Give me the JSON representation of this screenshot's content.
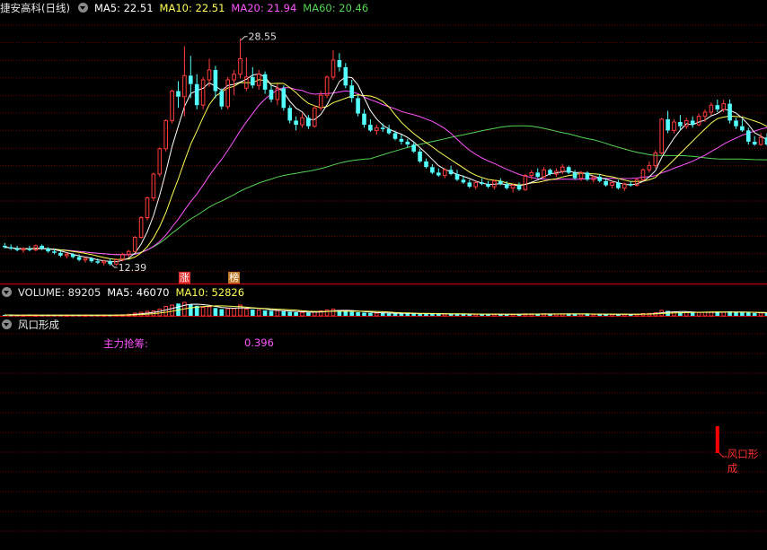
{
  "price_header": {
    "stock_name": "捷安高科",
    "period": "(日线)",
    "ma5": "MA5: 22.51",
    "ma10": "MA10: 22.51",
    "ma20": "MA20: 21.94",
    "ma60": "MA60: 20.46"
  },
  "volume_header": {
    "volume": "VOLUME: 89205",
    "ma5": "MA5: 46070",
    "ma10": "MA10: 52826"
  },
  "indicator_header": {
    "title": "风口形成"
  },
  "indicator": {
    "label": "主力抢筹:",
    "value": "0.396",
    "signal_label": "风口形成",
    "signal_candle_index": 115
  },
  "badges": [
    {
      "text": "涨",
      "candle_index": 29,
      "color": "#e03030"
    },
    {
      "text": "榜",
      "candle_index": 37,
      "color": "#c07a2a"
    }
  ],
  "colors": {
    "up": "#ff3c3c",
    "down": "#54ffff",
    "ma5": "#ffffff",
    "ma10": "#ffff54",
    "ma20": "#ff54ff",
    "ma60": "#54d454",
    "grid": "#7a0000",
    "divider": "#c00000",
    "indicator_text": "#ff54ff",
    "signal": "#ff0000"
  },
  "chart_data": {
    "type": "candlestick",
    "ylim": [
      11.5,
      30.0
    ],
    "annotations": [
      {
        "text": "28.55",
        "candle_index": 38,
        "price": 28.55,
        "kind": "high"
      },
      {
        "text": "12.39",
        "candle_index": 17,
        "price": 12.39,
        "kind": "low"
      }
    ],
    "ohlc": [
      [
        13.8,
        14.0,
        13.6,
        13.7
      ],
      [
        13.7,
        13.9,
        13.5,
        13.6
      ],
      [
        13.6,
        13.8,
        13.4,
        13.5
      ],
      [
        13.5,
        13.7,
        13.3,
        13.6
      ],
      [
        13.6,
        13.8,
        13.4,
        13.5
      ],
      [
        13.5,
        13.9,
        13.4,
        13.8
      ],
      [
        13.8,
        13.9,
        13.5,
        13.6
      ],
      [
        13.6,
        13.7,
        13.3,
        13.4
      ],
      [
        13.4,
        13.6,
        13.2,
        13.3
      ],
      [
        13.3,
        13.5,
        13.0,
        13.1
      ],
      [
        13.1,
        13.3,
        12.9,
        13.2
      ],
      [
        13.2,
        13.3,
        12.9,
        13.0
      ],
      [
        13.0,
        13.2,
        12.7,
        12.8
      ],
      [
        12.8,
        13.0,
        12.6,
        12.9
      ],
      [
        12.9,
        13.0,
        12.6,
        12.7
      ],
      [
        12.7,
        12.9,
        12.5,
        12.6
      ],
      [
        12.6,
        12.8,
        12.4,
        12.7
      ],
      [
        12.7,
        12.9,
        12.39,
        12.5
      ],
      [
        12.5,
        12.9,
        12.4,
        12.8
      ],
      [
        12.8,
        13.3,
        12.7,
        13.2
      ],
      [
        13.2,
        13.5,
        13.0,
        13.4
      ],
      [
        13.4,
        14.5,
        13.3,
        14.4
      ],
      [
        14.4,
        15.9,
        14.3,
        15.8
      ],
      [
        15.8,
        17.3,
        15.6,
        17.2
      ],
      [
        17.2,
        19.0,
        17.0,
        18.9
      ],
      [
        18.9,
        20.8,
        18.7,
        20.7
      ],
      [
        20.7,
        22.8,
        20.5,
        22.7
      ],
      [
        22.7,
        24.9,
        22.5,
        24.8
      ],
      [
        24.8,
        25.5,
        23.6,
        24.4
      ],
      [
        24.4,
        28.0,
        23.0,
        25.9
      ],
      [
        25.9,
        27.3,
        24.3,
        25.3
      ],
      [
        25.3,
        26.0,
        23.5,
        23.8
      ],
      [
        23.8,
        25.8,
        23.5,
        25.6
      ],
      [
        25.6,
        27.1,
        25.1,
        26.3
      ],
      [
        26.3,
        26.6,
        24.3,
        24.8
      ],
      [
        24.8,
        25.0,
        23.5,
        23.7
      ],
      [
        23.7,
        25.8,
        23.5,
        25.6
      ],
      [
        25.6,
        26.3,
        24.5,
        26.0
      ],
      [
        26.0,
        28.55,
        25.7,
        27.1
      ],
      [
        25.0,
        27.2,
        24.8,
        25.8
      ],
      [
        25.8,
        26.5,
        25.0,
        25.2
      ],
      [
        25.2,
        26.3,
        24.9,
        26.0
      ],
      [
        26.0,
        26.2,
        24.6,
        24.9
      ],
      [
        24.9,
        25.2,
        24.0,
        24.2
      ],
      [
        24.2,
        25.3,
        23.8,
        25.0
      ],
      [
        25.0,
        25.2,
        23.4,
        23.6
      ],
      [
        23.6,
        23.8,
        22.5,
        22.7
      ],
      [
        22.7,
        23.0,
        22.0,
        22.4
      ],
      [
        22.4,
        23.2,
        22.2,
        22.9
      ],
      [
        22.9,
        23.1,
        22.1,
        22.3
      ],
      [
        22.3,
        23.8,
        22.2,
        23.6
      ],
      [
        23.6,
        24.8,
        23.4,
        24.5
      ],
      [
        24.5,
        25.9,
        24.3,
        25.8
      ],
      [
        25.8,
        27.7,
        25.6,
        27.0
      ],
      [
        27.0,
        27.5,
        26.2,
        26.5
      ],
      [
        26.5,
        26.8,
        25.0,
        25.2
      ],
      [
        25.2,
        25.6,
        24.0,
        24.3
      ],
      [
        24.3,
        24.5,
        23.0,
        23.2
      ],
      [
        23.2,
        23.5,
        22.2,
        22.4
      ],
      [
        22.4,
        22.8,
        21.9,
        22.0
      ],
      [
        22.0,
        22.4,
        21.7,
        22.2
      ],
      [
        22.2,
        22.5,
        21.9,
        22.1
      ],
      [
        22.1,
        22.4,
        21.7,
        21.8
      ],
      [
        21.8,
        22.0,
        21.3,
        21.4
      ],
      [
        21.4,
        21.7,
        21.0,
        21.2
      ],
      [
        21.2,
        21.4,
        20.8,
        21.0
      ],
      [
        21.0,
        21.2,
        20.4,
        20.5
      ],
      [
        20.5,
        20.7,
        19.7,
        19.8
      ],
      [
        19.8,
        20.0,
        19.3,
        19.4
      ],
      [
        19.4,
        19.6,
        18.9,
        19.0
      ],
      [
        19.0,
        19.3,
        18.7,
        18.8
      ],
      [
        18.8,
        19.3,
        18.6,
        19.2
      ],
      [
        19.2,
        19.5,
        18.8,
        18.9
      ],
      [
        18.9,
        19.2,
        18.4,
        18.5
      ],
      [
        18.5,
        18.8,
        18.2,
        18.3
      ],
      [
        18.3,
        18.5,
        17.9,
        18.0
      ],
      [
        18.0,
        18.4,
        17.8,
        18.3
      ],
      [
        18.3,
        18.6,
        18.1,
        18.2
      ],
      [
        18.2,
        18.4,
        17.9,
        18.0
      ],
      [
        18.0,
        18.5,
        17.8,
        18.4
      ],
      [
        18.4,
        18.6,
        18.1,
        18.2
      ],
      [
        18.2,
        18.4,
        17.8,
        17.9
      ],
      [
        17.9,
        18.2,
        17.6,
        18.1
      ],
      [
        18.1,
        18.3,
        17.7,
        17.8
      ],
      [
        17.8,
        18.9,
        17.7,
        18.8
      ],
      [
        18.8,
        19.2,
        18.5,
        19.0
      ],
      [
        19.0,
        19.3,
        18.6,
        18.7
      ],
      [
        18.7,
        19.4,
        18.6,
        19.2
      ],
      [
        19.2,
        19.3,
        18.8,
        18.9
      ],
      [
        18.9,
        19.3,
        18.7,
        19.1
      ],
      [
        19.1,
        19.6,
        18.9,
        19.4
      ],
      [
        19.4,
        19.5,
        18.9,
        19.0
      ],
      [
        19.0,
        19.2,
        18.5,
        18.6
      ],
      [
        18.6,
        19.1,
        18.4,
        19.0
      ],
      [
        19.0,
        19.1,
        18.4,
        18.5
      ],
      [
        18.5,
        18.8,
        18.3,
        18.7
      ],
      [
        18.7,
        18.9,
        18.3,
        18.4
      ],
      [
        18.4,
        18.6,
        18.0,
        18.1
      ],
      [
        18.1,
        18.4,
        17.9,
        18.3
      ],
      [
        18.3,
        18.5,
        17.8,
        17.9
      ],
      [
        17.9,
        18.3,
        17.7,
        18.2
      ],
      [
        18.2,
        18.4,
        18.0,
        18.1
      ],
      [
        18.1,
        18.6,
        18.0,
        18.5
      ],
      [
        18.5,
        19.3,
        18.4,
        19.2
      ],
      [
        19.2,
        19.8,
        19.0,
        19.5
      ],
      [
        19.5,
        20.6,
        19.3,
        20.4
      ],
      [
        20.4,
        22.9,
        20.3,
        22.8
      ],
      [
        22.8,
        23.4,
        21.8,
        22.0
      ],
      [
        22.0,
        22.8,
        21.8,
        22.6
      ],
      [
        22.6,
        23.1,
        22.0,
        22.3
      ],
      [
        22.3,
        22.9,
        22.1,
        22.7
      ],
      [
        22.7,
        23.0,
        22.2,
        22.4
      ],
      [
        22.4,
        23.2,
        22.3,
        23.0
      ],
      [
        23.0,
        23.5,
        22.6,
        23.3
      ],
      [
        23.3,
        24.0,
        23.1,
        23.8
      ],
      [
        23.8,
        24.2,
        23.3,
        23.5
      ],
      [
        23.5,
        24.2,
        23.3,
        23.9
      ],
      [
        23.9,
        24.2,
        22.5,
        22.7
      ],
      [
        22.7,
        22.9,
        22.1,
        22.3
      ],
      [
        22.3,
        22.8,
        21.9,
        22.0
      ],
      [
        22.0,
        22.2,
        21.0,
        21.2
      ],
      [
        21.2,
        21.6,
        20.9,
        21.0
      ],
      [
        21.0,
        21.8,
        20.9,
        21.5
      ],
      [
        21.5,
        21.8,
        20.9,
        21.0
      ],
      [
        21.0,
        21.4,
        20.8,
        21.3
      ]
    ],
    "volume": [
      4,
      3,
      3,
      3,
      4,
      3,
      3,
      3,
      3,
      3,
      3,
      3,
      3,
      3,
      3,
      3,
      3,
      3,
      4,
      5,
      7,
      12,
      16,
      20,
      22,
      30,
      42,
      48,
      55,
      60,
      52,
      45,
      38,
      40,
      35,
      30,
      32,
      33,
      48,
      30,
      28,
      26,
      24,
      22,
      23,
      20,
      18,
      16,
      15,
      14,
      18,
      22,
      26,
      30,
      24,
      20,
      18,
      16,
      14,
      13,
      12,
      12,
      11,
      11,
      10,
      10,
      10,
      9,
      9,
      9,
      8,
      8,
      8,
      8,
      8,
      7,
      7,
      7,
      8,
      7,
      7,
      7,
      7,
      7,
      9,
      9,
      8,
      9,
      8,
      8,
      9,
      8,
      8,
      8,
      8,
      7,
      7,
      7,
      7,
      7,
      7,
      7,
      8,
      10,
      11,
      14,
      24,
      22,
      18,
      16,
      15,
      15,
      15,
      16,
      17,
      16,
      17,
      20,
      16,
      15,
      14,
      12,
      13,
      12,
      14
    ]
  }
}
